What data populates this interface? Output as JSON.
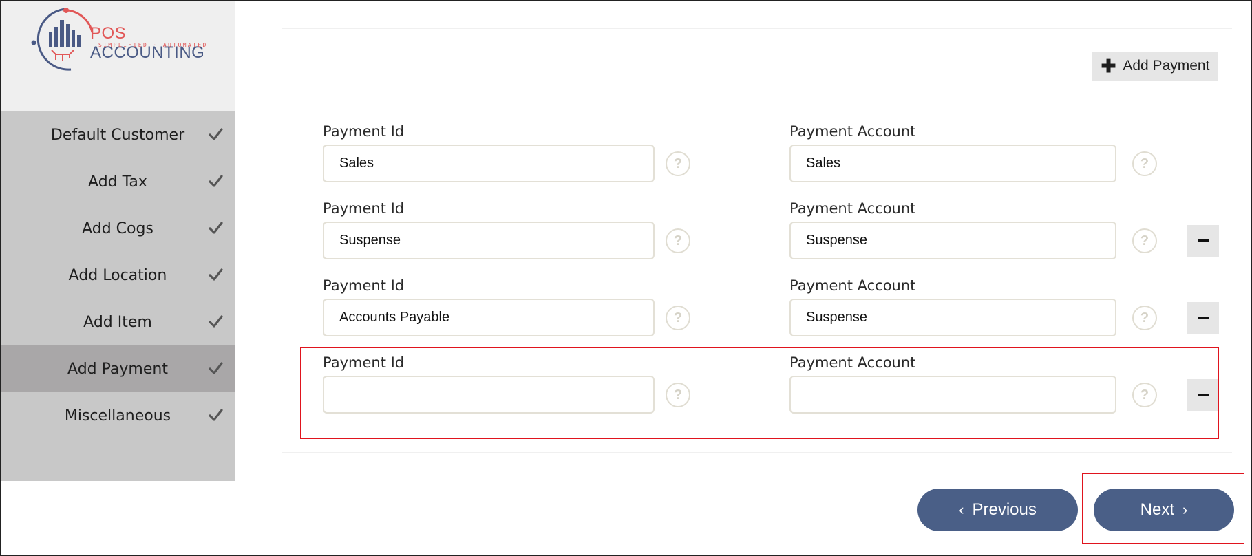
{
  "brand": {
    "name_prefix": "POS",
    "name_suffix": " ACCOUNTING",
    "tagline": "SIMPLIFIED · AUTOMATED",
    "colors": {
      "navy": "#4a5a85",
      "red": "#e15757"
    }
  },
  "sidebar": {
    "steps": [
      {
        "label": "Default Customer",
        "icon": "check-icon",
        "active": false
      },
      {
        "label": "Add Tax",
        "icon": "check-icon",
        "active": false
      },
      {
        "label": "Add Cogs",
        "icon": "check-icon",
        "active": false
      },
      {
        "label": "Add Location",
        "icon": "check-icon",
        "active": false
      },
      {
        "label": "Add Item",
        "icon": "check-icon",
        "active": false
      },
      {
        "label": "Add Payment",
        "icon": "check-icon",
        "active": true
      },
      {
        "label": "Miscellaneous",
        "icon": "check-icon",
        "active": false
      }
    ]
  },
  "toolbar": {
    "add_payment_label": "Add Payment",
    "add_icon": "plus-icon"
  },
  "payments": [
    {
      "id_label": "Payment Id",
      "id_value": "Sales",
      "account_label": "Payment Account",
      "account_value": "Sales",
      "removable": false
    },
    {
      "id_label": "Payment Id",
      "id_value": "Suspense",
      "account_label": "Payment Account",
      "account_value": "Suspense",
      "removable": true
    },
    {
      "id_label": "Payment Id",
      "id_value": "Accounts Payable",
      "account_label": "Payment Account",
      "account_value": "Suspense",
      "removable": true
    },
    {
      "id_label": "Payment Id",
      "id_value": "",
      "account_label": "Payment Account",
      "account_value": "",
      "removable": true
    }
  ],
  "help_glyph": "?",
  "nav": {
    "previous_label": "Previous",
    "next_label": "Next",
    "previous_icon": "‹",
    "next_icon": "›"
  },
  "colors": {
    "primary": "#4a5f87",
    "highlight": "#e0141e",
    "sidebar": "#c8c8c8",
    "sidebar_active": "#a9a7a8"
  }
}
